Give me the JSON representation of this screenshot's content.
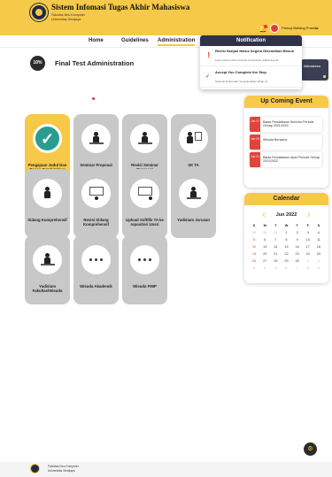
{
  "header": {
    "title": "Sistem Infomasi Tugas Akhir Mahasiswa",
    "subtitle_line1": "Fakultas Ilmu Komputer",
    "subtitle_line2": "Universitas Sriwijaya",
    "username": "Pamuji Baliang Prawiro",
    "brand_color": "#f7c948"
  },
  "nav": {
    "items": [
      "Home",
      "Guidelines",
      "Administration"
    ],
    "active": "Administration"
  },
  "page": {
    "progress": "10%",
    "progress_value": 10,
    "title": "Final Test Administration",
    "banner_text": "Mahasiswa"
  },
  "steps": [
    {
      "label": "Pengajuan Judul Dan Dosen Pembimbing",
      "status": "done",
      "icon": "check-icon"
    },
    {
      "label": "Seminar Proposal",
      "status": "locked",
      "icon": "presentation-icon"
    },
    {
      "label": "Revisi Seminar Proposal",
      "status": "locked",
      "icon": "revision-icon"
    },
    {
      "label": "SK TA",
      "status": "locked",
      "icon": "document-icon"
    },
    {
      "label": "Sidang Komprehensif",
      "status": "locked",
      "icon": "defense-icon"
    },
    {
      "label": "Revisi Sidang Komprehensif",
      "status": "locked",
      "icon": "revision-icon"
    },
    {
      "label": "Upload Softfile TA ke repositori Unsri",
      "status": "locked",
      "icon": "upload-icon"
    },
    {
      "label": "Yudisium Jurusan",
      "status": "locked",
      "icon": "graduation-icon"
    },
    {
      "label": "Yudisium Fakultas/Wisuda",
      "status": "locked",
      "icon": "graduation-icon"
    },
    {
      "label": "Wisuda Akademik",
      "status": "locked",
      "icon": "ceremony-icon"
    },
    {
      "label": "Wisuda FMIP",
      "status": "locked",
      "icon": "ceremony-icon"
    }
  ],
  "notification": {
    "title": "Notification",
    "items": [
      {
        "title": "Revisi Skripsi Harus Segera Diserahkan Besok",
        "body": "Lorem ipsum dolor sit amet consectetur adipiscing elit"
      },
      {
        "title": "Accept You Complete the Step",
        "body": "Selamat Anda telah menyelesaikan tahap ini"
      }
    ]
  },
  "events": {
    "title": "Up Coming Event",
    "items": [
      {
        "date": "Jun 17",
        "text": "Batas Pendaftaran Seminar Periode Genap 2021/2022"
      },
      {
        "date": "Jun 20",
        "text": "Wisuda Bersama"
      },
      {
        "date": "Jun 21",
        "text": "Batas Pendaftaran Ujian Periode Genap 2021/2022"
      }
    ]
  },
  "calendar": {
    "title": "Calendar",
    "month": "Jun 2022",
    "weekdays": [
      "S",
      "M",
      "T",
      "W",
      "T",
      "F",
      "S"
    ],
    "days": [
      "29",
      "30",
      "31",
      "1",
      "2",
      "3",
      "4",
      "5",
      "6",
      "7",
      "8",
      "9",
      "10",
      "11",
      "12",
      "13",
      "14",
      "15",
      "16",
      "17",
      "18",
      "19",
      "20",
      "21",
      "22",
      "23",
      "24",
      "25",
      "26",
      "27",
      "28",
      "29",
      "30",
      "1",
      "2",
      "3",
      "4",
      "5",
      "6",
      "7",
      "8",
      "9"
    ]
  },
  "footer": {
    "line1": "Fakultas Ilmu Komputer",
    "line2": "Universitas Sriwijaya"
  }
}
